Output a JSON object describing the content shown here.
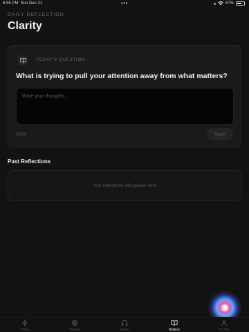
{
  "status_bar": {
    "time": "6:55 PM",
    "date": "Sun Dec 21",
    "battery": "67%",
    "battery_level": 0.67,
    "dots": "•••"
  },
  "header": {
    "eyebrow": "DAILY REFLECTION",
    "title": "Clarity"
  },
  "question_card": {
    "eyebrow": "TODAY'S QUESTION",
    "question": "What is trying to pull your attention away from what matters?",
    "input_placeholder": "Write your thoughts...",
    "input_value": "",
    "counter": "0/500",
    "save_label": "Save"
  },
  "past": {
    "title": "Past Reflections",
    "empty_text": "Your reflections will appear here"
  },
  "tabs": [
    {
      "label": "Today",
      "icon": "lightning-icon"
    },
    {
      "label": "Breath",
      "icon": "target-icon"
    },
    {
      "label": "Audio",
      "icon": "headphones-icon"
    },
    {
      "label": "Reflect",
      "icon": "book-icon",
      "active": true
    },
    {
      "label": "Profile",
      "icon": "person-icon"
    }
  ],
  "colors": {
    "background": "#121212",
    "card": "#1a1a1a",
    "input": "#050505",
    "accent_dot": "#f08a24"
  }
}
